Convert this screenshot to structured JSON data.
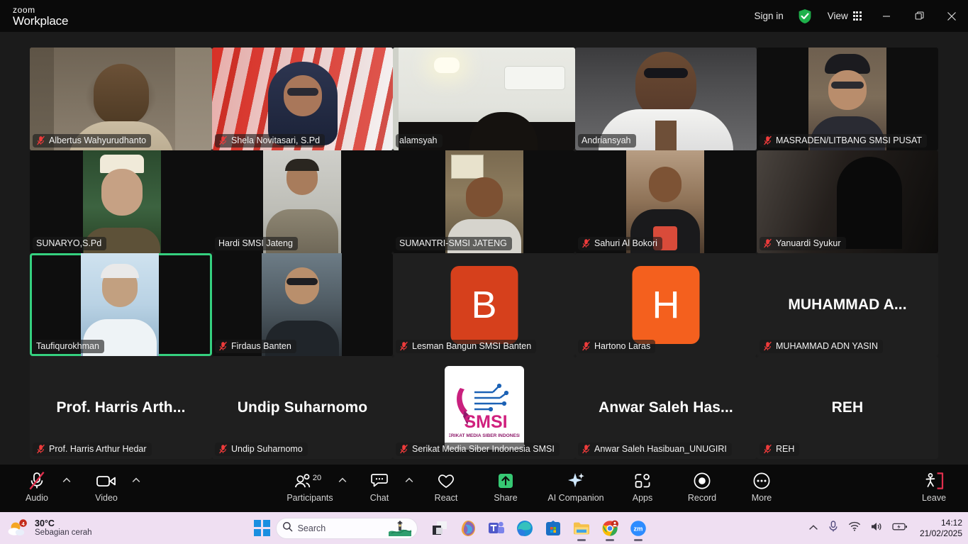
{
  "titlebar": {
    "brand_top": "zoom",
    "brand_bottom": "Workplace",
    "sign_in": "Sign in",
    "view": "View",
    "shield_icon": "shield-check-icon",
    "grid_icon": "grid-view-icon",
    "minimize_icon": "minimize-icon",
    "restore_icon": "restore-icon",
    "close_icon": "close-icon"
  },
  "meeting": {
    "active_speaker": "Taufiqurokhman",
    "participants": [
      {
        "name": "Albertus Wahyurudhanto",
        "muted": true,
        "kind": "video"
      },
      {
        "name": "Shela Novitasari, S.Pd",
        "muted": true,
        "kind": "video"
      },
      {
        "name": "alamsyah",
        "muted": false,
        "kind": "video"
      },
      {
        "name": "Andriansyah",
        "muted": false,
        "kind": "video"
      },
      {
        "name": "MASRADEN/LITBANG SMSI PUSAT",
        "muted": true,
        "kind": "video"
      },
      {
        "name": "SUNARYO,S.Pd",
        "muted": false,
        "kind": "video"
      },
      {
        "name": "Hardi SMSI Jateng",
        "muted": false,
        "kind": "video"
      },
      {
        "name": "SUMANTRI-SMSI JATENG",
        "muted": false,
        "kind": "video"
      },
      {
        "name": "Sahuri Al Bokori",
        "muted": true,
        "kind": "video"
      },
      {
        "name": "Yanuardi Syukur",
        "muted": true,
        "kind": "video"
      },
      {
        "name": "Taufiqurokhman",
        "muted": false,
        "kind": "video"
      },
      {
        "name": "Firdaus Banten",
        "muted": true,
        "kind": "video"
      },
      {
        "name": "Lesman Bangun SMSI Banten",
        "muted": true,
        "kind": "avatar",
        "initial": "B",
        "avatar_color": "#d6401c"
      },
      {
        "name": "Hartono Laras",
        "muted": true,
        "kind": "avatar",
        "initial": "H",
        "avatar_color": "#f4601e"
      },
      {
        "name": "MUHAMMAD ADN YASIN",
        "muted": true,
        "kind": "name",
        "display": "MUHAMMAD  A..."
      },
      {
        "name": "Prof. Harris Arthur Hedar",
        "muted": true,
        "kind": "name",
        "display": "Prof. Harris Arth..."
      },
      {
        "name": "Undip Suharnomo",
        "muted": true,
        "kind": "name",
        "display": "Undip Suharnomo"
      },
      {
        "name": "Serikat Media Siber Indonesia SMSI",
        "muted": true,
        "kind": "logo",
        "logo_title": "SMSI",
        "logo_tagline": "SERIKAT MEDIA SIBER INDONESIA"
      },
      {
        "name": "Anwar Saleh Hasibuan_UNUGIRI",
        "muted": true,
        "kind": "name",
        "display": "Anwar Saleh Has..."
      },
      {
        "name": "REH",
        "muted": true,
        "kind": "name",
        "display": "REH"
      }
    ]
  },
  "toolbar": {
    "audio": {
      "label": "Audio",
      "icon": "microphone-muted-icon",
      "muted": true
    },
    "video": {
      "label": "Video",
      "icon": "camera-icon"
    },
    "participants": {
      "label": "Participants",
      "icon": "participants-icon",
      "count": "20"
    },
    "chat": {
      "label": "Chat",
      "icon": "chat-bubble-icon"
    },
    "react": {
      "label": "React",
      "icon": "heart-icon"
    },
    "share": {
      "label": "Share",
      "icon": "share-screen-icon",
      "accent": "#36c873"
    },
    "ai_companion": {
      "label": "AI Companion",
      "icon": "ai-sparkle-icon"
    },
    "apps": {
      "label": "Apps",
      "icon": "apps-icon"
    },
    "record": {
      "label": "Record",
      "icon": "record-icon"
    },
    "more": {
      "label": "More",
      "icon": "more-ellipsis-icon"
    },
    "leave": {
      "label": "Leave",
      "icon": "leave-door-icon",
      "accent": "#e02f4d"
    }
  },
  "taskbar": {
    "weather": {
      "temp": "30°C",
      "condition": "Sebagian cerah",
      "badge": "4",
      "icon": "weather-partly-sunny-icon"
    },
    "start_icon": "windows-start-icon",
    "search": {
      "placeholder": "Search",
      "icon": "search-icon"
    },
    "apps": [
      {
        "name": "task-view-icon"
      },
      {
        "name": "copilot-icon"
      },
      {
        "name": "microsoft-teams-icon"
      },
      {
        "name": "microsoft-edge-icon"
      },
      {
        "name": "microsoft-store-icon"
      },
      {
        "name": "file-explorer-icon"
      },
      {
        "name": "google-chrome-icon"
      },
      {
        "name": "zoom-icon"
      }
    ],
    "tray": {
      "chevron_icon": "show-hidden-icons-icon",
      "mic_icon": "microphone-tray-icon",
      "wifi_icon": "wifi-icon",
      "volume_icon": "volume-icon",
      "battery_icon": "battery-charging-icon",
      "time": "14:12",
      "date": "21/02/2025"
    }
  }
}
